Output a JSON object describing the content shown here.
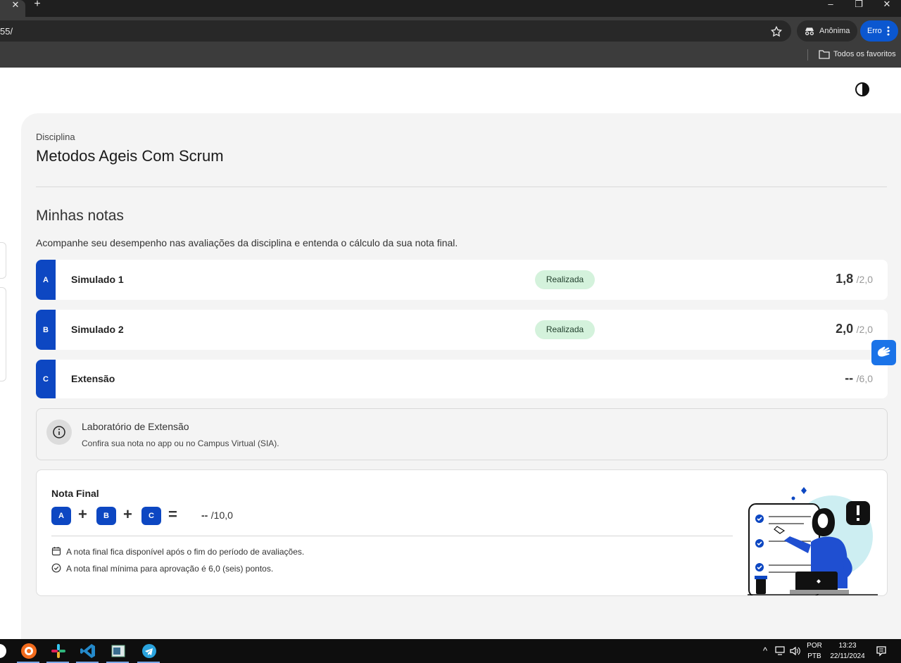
{
  "browser": {
    "url_fragment": "55/",
    "incognito_label": "Anônima",
    "profile_label": "Erro",
    "bookmark_folder": "Todos os favoritos"
  },
  "course": {
    "label": "Disciplina",
    "title": "Metodos Ageis Com Scrum"
  },
  "grades_section": {
    "title": "Minhas notas",
    "description": "Acompanhe seu desempenho nas avaliações da disciplina e entenda o cálculo da sua nota final.",
    "items": [
      {
        "letter": "A",
        "name": "Simulado 1",
        "status": "Realizada",
        "score": "1,8",
        "max": "/2,0"
      },
      {
        "letter": "B",
        "name": "Simulado 2",
        "status": "Realizada",
        "score": "2,0",
        "max": "/2,0"
      },
      {
        "letter": "C",
        "name": "Extensão",
        "status": "",
        "score": "--",
        "max": "/6,0"
      }
    ]
  },
  "info": {
    "title": "Laboratório de Extensão",
    "subtitle": "Confira sua nota no app ou no Campus Virtual (SIA)."
  },
  "final": {
    "title": "Nota Final",
    "chips": [
      "A",
      "B",
      "C"
    ],
    "plus": "+",
    "equals": "=",
    "value": "--",
    "max": "/10,0",
    "notes": [
      "A nota final fica disponível após o fim do período de avaliações.",
      "A nota final mínima para aprovação é 6,0 (seis) pontos."
    ]
  },
  "taskbar": {
    "lang_top": "POR",
    "lang_bottom": "PTB",
    "time": "13:23",
    "date": "22/11/2024"
  },
  "colors": {
    "accent": "#0d47c2",
    "badge_bg": "#d4f2dc",
    "accessibility": "#1a73e8"
  }
}
